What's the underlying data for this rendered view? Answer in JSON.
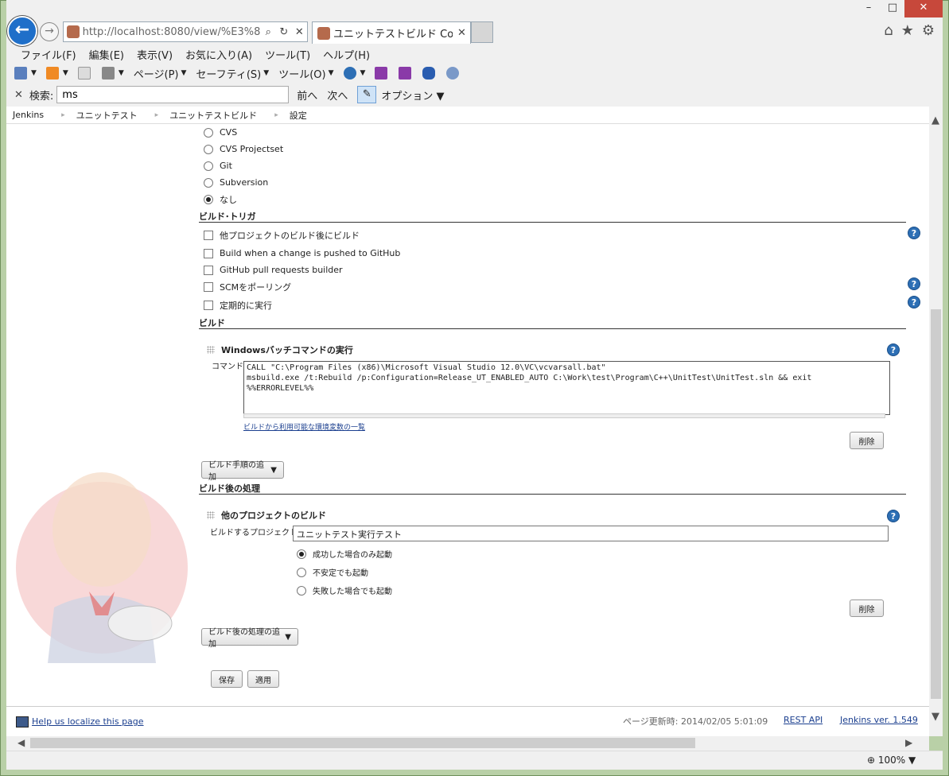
{
  "browser": {
    "url": "http://localhost:8080/view/%E3%83%",
    "url_host": "localhost",
    "tab_title": "ユニットテストビルド Config [J...",
    "window_controls": [
      "minimize",
      "maximize",
      "close"
    ]
  },
  "menu": [
    "ファイル(F)",
    "編集(E)",
    "表示(V)",
    "お気に入り(A)",
    "ツール(T)",
    "ヘルプ(H)"
  ],
  "command_bar": {
    "page": "ページ(P)",
    "safety": "セーフティ(S)",
    "tools": "ツール(O)"
  },
  "find": {
    "label": "検索:",
    "value": "ms",
    "prev": "前へ",
    "next": "次へ",
    "options": "オプション"
  },
  "breadcrumb": [
    "Jenkins",
    "ユニットテスト",
    "ユニットテストビルド",
    "設定"
  ],
  "scm": {
    "options": [
      "CVS",
      "CVS Projectset",
      "Git",
      "Subversion",
      "なし"
    ],
    "selected": "なし"
  },
  "build_triggers": {
    "title": "ビルド･トリガ",
    "options": [
      "他プロジェクトのビルド後にビルド",
      "Build when a change is pushed to GitHub",
      "GitHub pull requests builder",
      "SCMをポーリング",
      "定期的に実行"
    ]
  },
  "build": {
    "title": "ビルド",
    "step_title": "Windowsバッチコマンドの実行",
    "command_label": "コマンド",
    "command": "CALL \"C:\\Program Files (x86)\\Microsoft Visual Studio 12.0\\VC\\vcvarsall.bat\"\nmsbuild.exe /t:Rebuild /p:Configuration=Release_UT_ENABLED_AUTO C:\\Work\\test\\Program\\C++\\UnitTest\\UnitTest.sln && exit\n%%ERRORLEVEL%%",
    "env_link": "ビルドから利用可能な環境変数の一覧",
    "delete": "削除",
    "add_step": "ビルド手順の追加"
  },
  "post_build": {
    "title": "ビルド後の処理",
    "step_title": "他のプロジェクトのビルド",
    "project_label": "ビルドするプロジェクト",
    "project_value": "ユニットテスト実行テスト",
    "conditions": [
      "成功した場合のみ起動",
      "不安定でも起動",
      "失敗した場合でも起動"
    ],
    "selected": "成功した場合のみ起動",
    "delete": "削除",
    "add_action": "ビルド後の処理の追加"
  },
  "actions": {
    "save": "保存",
    "apply": "適用"
  },
  "footer": {
    "localize": "Help us localize this page",
    "updated": "ページ更新時: 2014/02/05 5:01:09",
    "rest_api": "REST API",
    "version": "Jenkins ver. 1.549"
  },
  "status": {
    "zoom": "100%"
  },
  "colors": {
    "accent": "#1f6fc9",
    "help": "#2d6fb5",
    "link": "#1b3f8f",
    "close": "#c7483b"
  }
}
